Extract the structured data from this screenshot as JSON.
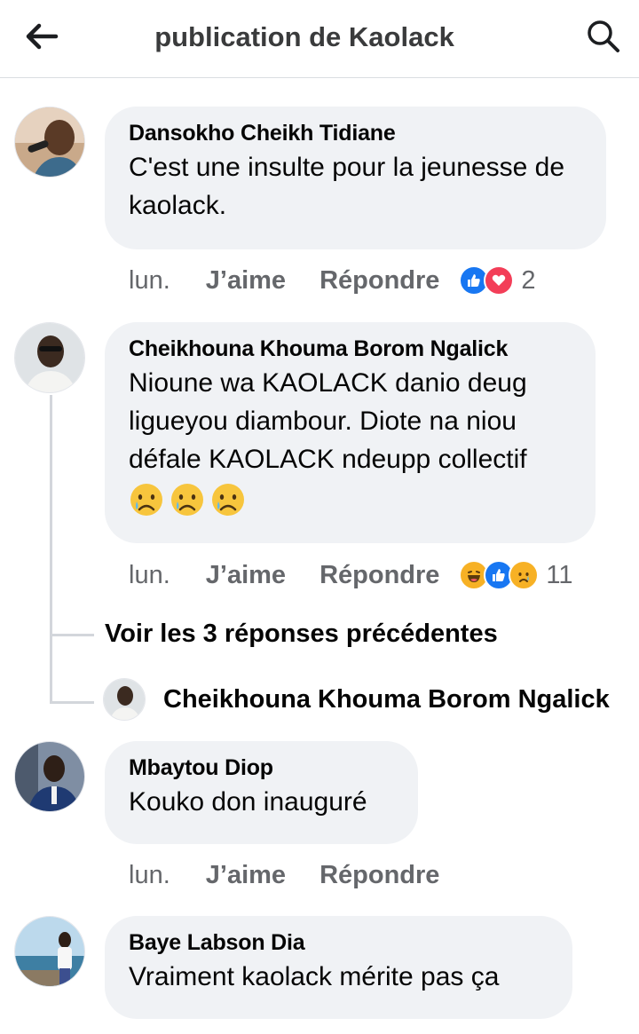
{
  "header": {
    "title": "publication de Kaolack",
    "back_icon": "arrow-left-icon",
    "search_icon": "search-icon"
  },
  "comments": [
    {
      "author": "Dansokho Cheikh Tidiane",
      "text": "C'est une insulte pour  la jeunesse de kaolack.",
      "time": "lun.",
      "like": "J’aime",
      "reply": "Répondre",
      "reactions": [
        "like-reaction-icon",
        "love-reaction-icon"
      ],
      "reaction_count": "2"
    },
    {
      "author": "Cheikhouna Khouma Borom Ngalick",
      "text": "Nioune wa KAOLACK danio deug ligueyou diambour. Diote na niou défale KAOLACK ndeupp collectif",
      "emojis": [
        "crying-face-emoji",
        "crying-face-emoji",
        "crying-face-emoji"
      ],
      "time": "lun.",
      "like": "J’aime",
      "reply": "Répondre",
      "reactions": [
        "haha-reaction-icon",
        "like-reaction-icon",
        "sad-reaction-icon"
      ],
      "reaction_count": "11"
    },
    {
      "author": "Mbaytou Diop",
      "text": "Kouko don inauguré",
      "time": "lun.",
      "like": "J’aime",
      "reply": "Répondre"
    },
    {
      "author": "Baye Labson Dia",
      "text": "Vraiment kaolack mérite pas ça"
    }
  ],
  "thread": {
    "view_replies": "Voir les 3 réponses précédentes",
    "reply_author": "Cheikhouna Khouma Borom Ngalick"
  },
  "colors": {
    "bubble": "#f0f2f5",
    "secondary_text": "#65676b",
    "like_blue": "#1877f2",
    "love_red": "#f33e58",
    "haha_yellow": "#f7b125"
  }
}
